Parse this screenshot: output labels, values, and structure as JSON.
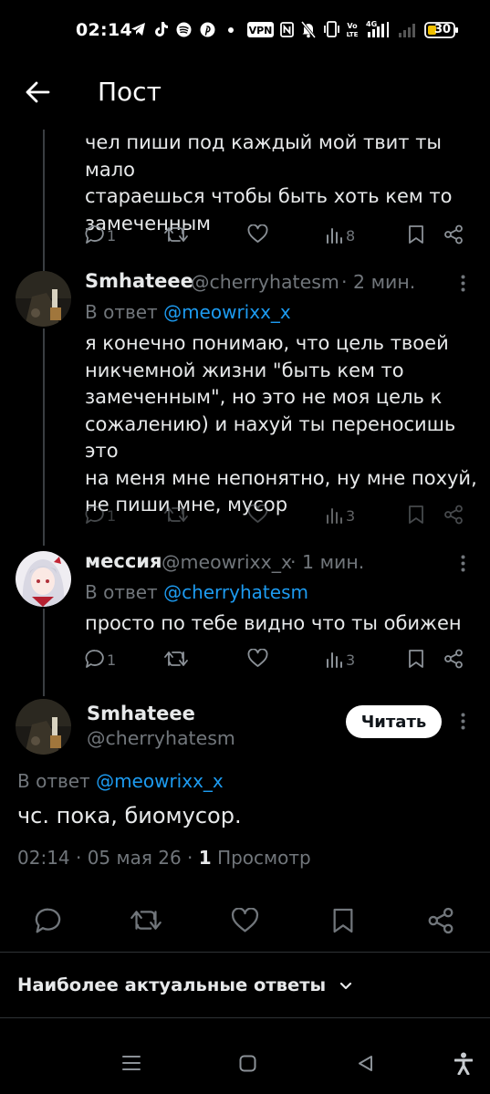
{
  "status_bar": {
    "time": "02:14",
    "battery": "30"
  },
  "header": {
    "title": "Пост"
  },
  "tweets": [
    {
      "text_lines": [
        "чел пиши под каждый мой твит ты мало",
        "стараешься чтобы быть хоть кем то",
        "замеченным"
      ],
      "replies": "1",
      "views": "8"
    },
    {
      "name": "Smhateee",
      "handle": "@cherryhatesm",
      "time": "· 2 мин.",
      "reply_prefix": "В ответ",
      "reply_mention": "@meowrixx_x",
      "text_lines": [
        "я конечно понимаю, что цель твоей",
        "никчемной жизни \"быть кем то",
        "замеченным\", но это не моя цель к",
        "сожалению) и нахуй ты переносишь это",
        "на меня мне непонятно, ну мне похуй,",
        "не пиши мне, мусор"
      ],
      "replies": "1",
      "views": "3"
    },
    {
      "name": "мессия",
      "handle": "@meowrixx_x",
      "time": "· 1 мин.",
      "reply_prefix": "В ответ",
      "reply_mention": "@cherryhatesm",
      "text_lines": [
        "просто по тебе видно что ты обижен"
      ],
      "replies": "1",
      "views": "3"
    }
  ],
  "main_post": {
    "name": "Smhateee",
    "handle": "@cherryhatesm",
    "follow_label": "Читать",
    "reply_prefix": "В ответ",
    "reply_mention": "@meowrixx_x",
    "text": "чс. пока, биомусор.",
    "time": "02:14 · 05 мая 26 ·",
    "views_count": "1",
    "views_label": "Просмотр"
  },
  "replies_sort": {
    "label": "Наиболее актуальные ответы"
  },
  "colors": {
    "background": "#000000",
    "text": "#e7e9ea",
    "muted": "#71767b",
    "link": "#1d9bf0"
  }
}
